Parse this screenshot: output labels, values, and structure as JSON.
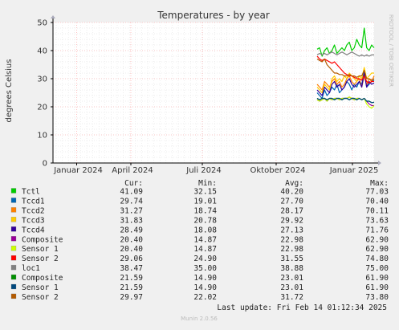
{
  "chart_data": {
    "type": "line",
    "title": "Temperatures - by year",
    "ylabel": "degrees Celsius",
    "xlabel": "",
    "ylim": [
      0,
      50
    ],
    "yticks": [
      0,
      10,
      20,
      30,
      40,
      50
    ],
    "x_tick_labels": [
      "Januar 2024",
      "April 2024",
      "Juli 2024",
      "Oktober 2024",
      "Januar 2025"
    ],
    "grid": true,
    "legend_placement": "bottom",
    "side_label": "RRDTOOL / TOBI OETIKER",
    "series": [
      {
        "name": "Tctl",
        "color": "#00cc00",
        "values": [
          40.5,
          41,
          38,
          40,
          41,
          39,
          40,
          42,
          39,
          40,
          41,
          40,
          42,
          43,
          40,
          41,
          44,
          42,
          41,
          48,
          41,
          40,
          42,
          41
        ]
      },
      {
        "name": "Tccd1",
        "color": "#0066b3",
        "values": [
          25,
          24,
          23,
          26,
          24,
          25,
          27,
          26,
          28,
          25,
          26,
          27,
          29,
          28,
          26,
          28,
          27,
          29,
          28,
          33,
          27,
          28,
          29,
          29.5
        ]
      },
      {
        "name": "Tccd2",
        "color": "#ff8000",
        "values": [
          28,
          27,
          26,
          29,
          28,
          27,
          29,
          30,
          28,
          29,
          27,
          28,
          30,
          31,
          29,
          28,
          29,
          30,
          27,
          31,
          28,
          30,
          29,
          31
        ]
      },
      {
        "name": "Tccd3",
        "color": "#ffcc00",
        "values": [
          27,
          26,
          25,
          28,
          27,
          26,
          30,
          31,
          29,
          30,
          29,
          31,
          30,
          32,
          31,
          30,
          29,
          31,
          30,
          34,
          30,
          31,
          32,
          32
        ]
      },
      {
        "name": "Tccd4",
        "color": "#330099",
        "values": [
          26,
          25,
          24,
          27,
          26,
          25,
          28,
          29,
          27,
          28,
          26,
          27,
          29,
          30,
          28,
          27,
          28,
          29,
          27,
          32,
          27,
          29,
          28,
          28.5
        ]
      },
      {
        "name": "Composite",
        "color": "#990099",
        "values": [
          22.5,
          22,
          22.5,
          23,
          22,
          23,
          22.5,
          23,
          23,
          22.5,
          23,
          23,
          23,
          23.5,
          23,
          22.5,
          23,
          23,
          22.5,
          23,
          22,
          21,
          20.5,
          20.4
        ]
      },
      {
        "name": "Sensor 1",
        "color": "#ccff00",
        "values": [
          22.5,
          22,
          22.5,
          23,
          22,
          23,
          22.5,
          23,
          23,
          22.5,
          23,
          23,
          23,
          23.5,
          23,
          22.5,
          23,
          23,
          22.5,
          23,
          21,
          20,
          19.5,
          20.4
        ]
      },
      {
        "name": "Sensor 2",
        "color": "#ff0000",
        "values": [
          38,
          37,
          36.5,
          37,
          36.5,
          36,
          35.5,
          36,
          35,
          34,
          33,
          32,
          31.5,
          31,
          31,
          30.5,
          30,
          30,
          29.5,
          31,
          29,
          28.5,
          29,
          29.06
        ]
      },
      {
        "name": "loc1",
        "color": "#808080",
        "values": [
          38.5,
          39,
          38.5,
          39,
          38.5,
          39,
          39.5,
          39,
          38.5,
          39,
          39.5,
          39,
          38.5,
          39,
          39.5,
          39,
          38.5,
          38,
          38.5,
          38,
          38.5,
          38,
          38.5,
          38.47
        ]
      },
      {
        "name": "Composite",
        "color": "#008f00",
        "values": [
          23,
          22.5,
          23,
          23,
          22.5,
          23,
          23,
          22.5,
          23,
          23,
          22.5,
          23,
          23,
          22.5,
          23,
          23,
          22.5,
          23,
          22.5,
          23,
          22,
          22,
          21.5,
          21.59
        ]
      },
      {
        "name": "Sensor 1",
        "color": "#00487d",
        "values": [
          23,
          22.5,
          23,
          23,
          22.5,
          23,
          23,
          22.5,
          23,
          23,
          22.5,
          23,
          23,
          22.5,
          23,
          23,
          22.5,
          23,
          22.5,
          23,
          22,
          22,
          21.5,
          21.59
        ]
      },
      {
        "name": "Sensor 2",
        "color": "#b35a00",
        "values": [
          37,
          36.5,
          36,
          37,
          35,
          34,
          33,
          32,
          32,
          31.5,
          31.5,
          31,
          31,
          31.5,
          31,
          31,
          30.5,
          31,
          31,
          33,
          30,
          30,
          29.5,
          29.97
        ]
      }
    ]
  },
  "legend": {
    "headers": {
      "cur": "Cur:",
      "min": "Min:",
      "avg": "Avg:",
      "max": "Max:"
    },
    "rows": [
      {
        "name": "Tctl",
        "color": "#00cc00",
        "cur": "41.09",
        "min": "32.15",
        "avg": "40.20",
        "max": "77.03"
      },
      {
        "name": "Tccd1",
        "color": "#0066b3",
        "cur": "29.74",
        "min": "19.01",
        "avg": "27.70",
        "max": "70.40"
      },
      {
        "name": "Tccd2",
        "color": "#ff8000",
        "cur": "31.27",
        "min": "18.74",
        "avg": "28.17",
        "max": "70.11"
      },
      {
        "name": "Tccd3",
        "color": "#ffcc00",
        "cur": "31.83",
        "min": "20.78",
        "avg": "29.92",
        "max": "73.63"
      },
      {
        "name": "Tccd4",
        "color": "#330099",
        "cur": "28.49",
        "min": "18.08",
        "avg": "27.13",
        "max": "71.76"
      },
      {
        "name": "Composite",
        "color": "#990099",
        "cur": "20.40",
        "min": "14.87",
        "avg": "22.98",
        "max": "62.90"
      },
      {
        "name": "Sensor 1",
        "color": "#ccff00",
        "cur": "20.40",
        "min": "14.87",
        "avg": "22.98",
        "max": "62.90"
      },
      {
        "name": "Sensor 2",
        "color": "#ff0000",
        "cur": "29.06",
        "min": "24.90",
        "avg": "31.55",
        "max": "74.80"
      },
      {
        "name": "loc1",
        "color": "#808080",
        "cur": "38.47",
        "min": "35.00",
        "avg": "38.88",
        "max": "75.00"
      },
      {
        "name": "Composite",
        "color": "#008f00",
        "cur": "21.59",
        "min": "14.90",
        "avg": "23.01",
        "max": "61.90"
      },
      {
        "name": "Sensor 1",
        "color": "#00487d",
        "cur": "21.59",
        "min": "14.90",
        "avg": "23.01",
        "max": "61.90"
      },
      {
        "name": "Sensor 2",
        "color": "#b35a00",
        "cur": "29.97",
        "min": "22.02",
        "avg": "31.72",
        "max": "73.80"
      }
    ]
  },
  "footer": {
    "last_update": "Last update: Fri Feb 14 01:12:34 2025",
    "munin": "Munin 2.0.56"
  },
  "colors": {
    "background": "#f0f0f0",
    "plot_background": "#ffffff",
    "grid_major": "#ff9999",
    "grid_minor": "#dddddd"
  }
}
